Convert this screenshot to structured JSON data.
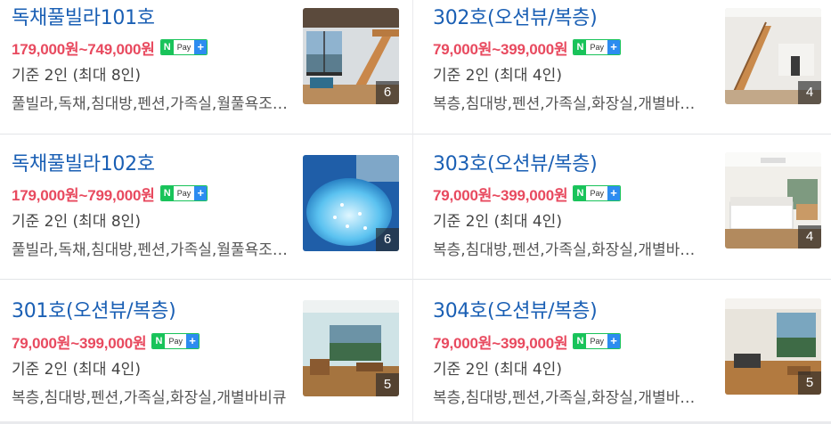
{
  "rooms": [
    {
      "name": "독채풀빌라101호",
      "price": "179,000원~749,000원",
      "capacity": "기준 2인 (최대 8인)",
      "tags": "풀빌라,독채,침대방,펜션,가족실,월풀욕조,바비큐",
      "photo_count": "6",
      "npay": {
        "n": "N",
        "pay": "Pay",
        "plus": "+"
      }
    },
    {
      "name": "독채풀빌라102호",
      "price": "179,000원~799,000원",
      "capacity": "기준 2인 (최대 8인)",
      "tags": "풀빌라,독채,침대방,펜션,가족실,월풀욕조,바비큐",
      "photo_count": "6",
      "npay": {
        "n": "N",
        "pay": "Pay",
        "plus": "+"
      }
    },
    {
      "name": "301호(오션뷰/복층)",
      "price": "79,000원~399,000원",
      "capacity": "기준 2인 (최대 4인)",
      "tags": "복층,침대방,펜션,가족실,화장실,개별바비큐",
      "photo_count": "5",
      "npay": {
        "n": "N",
        "pay": "Pay",
        "plus": "+"
      }
    },
    {
      "name": "302호(오션뷰/복층)",
      "price": "79,000원~399,000원",
      "capacity": "기준 2인 (최대 4인)",
      "tags": "복층,침대방,펜션,가족실,화장실,개별바비큐",
      "photo_count": "4",
      "npay": {
        "n": "N",
        "pay": "Pay",
        "plus": "+"
      }
    },
    {
      "name": "303호(오션뷰/복층)",
      "price": "79,000원~399,000원",
      "capacity": "기준 2인 (최대 4인)",
      "tags": "복층,침대방,펜션,가족실,화장실,개별바비큐",
      "photo_count": "4",
      "npay": {
        "n": "N",
        "pay": "Pay",
        "plus": "+"
      }
    },
    {
      "name": "304호(오션뷰/복층)",
      "price": "79,000원~399,000원",
      "capacity": "기준 2인 (최대 4인)",
      "tags": "복층,침대방,펜션,가족실,화장실,개별바비큐",
      "photo_count": "5",
      "npay": {
        "n": "N",
        "pay": "Pay",
        "plus": "+"
      }
    }
  ],
  "colors": {
    "name": "#1a5fb4",
    "price": "#e84a5f",
    "npay_green": "#19c35a",
    "npay_blue": "#2d8cf0"
  }
}
